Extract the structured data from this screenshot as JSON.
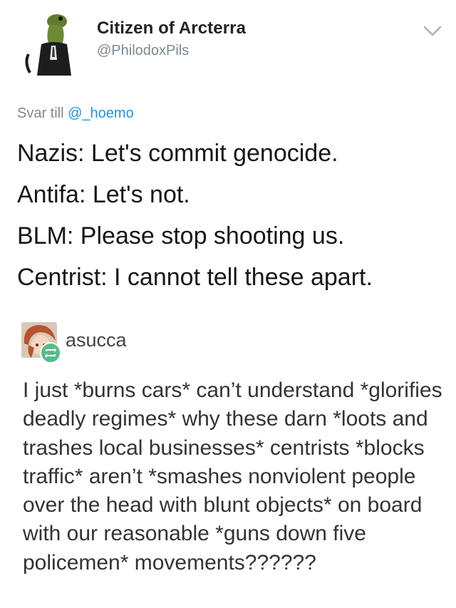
{
  "tweet": {
    "author_name": "Citizen of Arcterra",
    "author_handle": "@PhilodoxPils",
    "avatar_icon": "lizard-avatar-icon",
    "menu_icon": "chevron-down-icon",
    "reply_prefix": "Svar till ",
    "reply_mention": "@_hoemo",
    "lines": [
      "Nazis: Let's commit genocide.",
      "Antifa: Let's not.",
      "BLM: Please stop shooting us.",
      "Centrist: I cannot tell these apart."
    ],
    "colors": {
      "handle": "#7d8892",
      "mention": "#1b95e0"
    }
  },
  "reblog": {
    "username": "asucca",
    "avatar_icon": "anime-avatar-icon",
    "reblog_badge_icon": "reblog-icon",
    "text": "I just *burns cars* can’t understand *glorifies deadly regimes* why these darn *loots and trashes local businesses* centrists *blocks traffic* aren’t *smashes nonviolent people over the head with blunt objects* on board with our reasonable *guns down five policemen* movements??????",
    "colors": {
      "badge": "#56bc8a"
    }
  }
}
